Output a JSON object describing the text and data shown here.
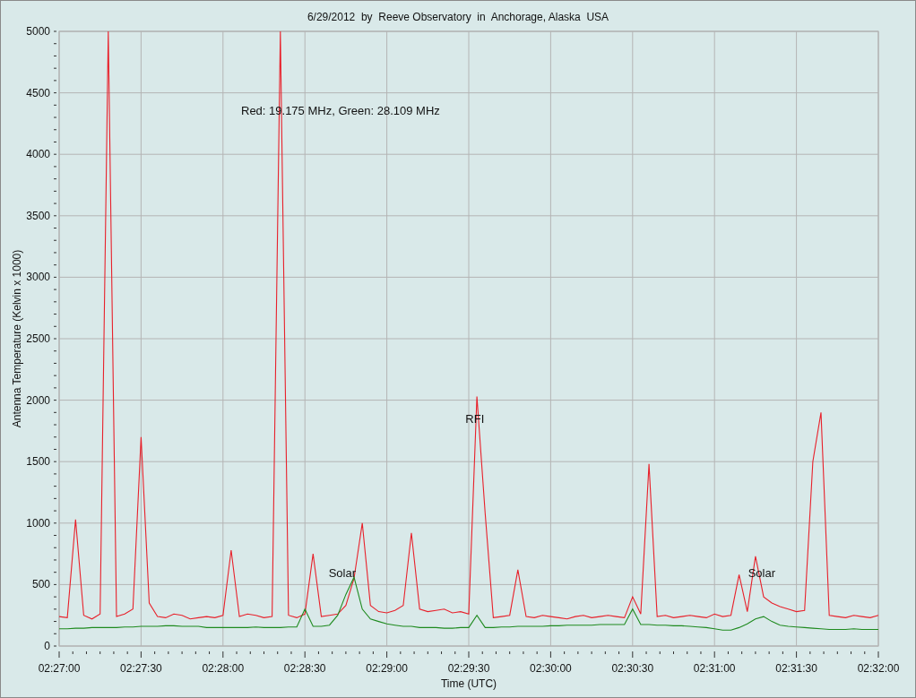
{
  "chart_data": {
    "type": "line",
    "title": "6/29/2012  by  Reeve Observatory  in  Anchorage, Alaska  USA",
    "xlabel": "Time (UTC)",
    "ylabel": "Antenna Temperature (Kelvin x 1000)",
    "categories": [
      "02:27:00",
      null,
      null,
      null,
      null,
      null,
      null,
      null,
      null,
      null,
      "02:27:30",
      null,
      null,
      null,
      null,
      null,
      null,
      null,
      null,
      null,
      "02:28:00",
      null,
      null,
      null,
      null,
      null,
      null,
      null,
      null,
      null,
      "02:28:30",
      null,
      null,
      null,
      null,
      null,
      null,
      null,
      null,
      null,
      "02:29:00",
      null,
      null,
      null,
      null,
      null,
      null,
      null,
      null,
      null,
      "02:29:30",
      null,
      null,
      null,
      null,
      null,
      null,
      null,
      null,
      null,
      "02:30:00",
      null,
      null,
      null,
      null,
      null,
      null,
      null,
      null,
      null,
      "02:30:30",
      null,
      null,
      null,
      null,
      null,
      null,
      null,
      null,
      null,
      "02:31:00",
      null,
      null,
      null,
      null,
      null,
      null,
      null,
      null,
      null,
      "02:31:30",
      null,
      null,
      null,
      null,
      null,
      null,
      null,
      null,
      null,
      "02:32:00"
    ],
    "series": [
      {
        "name": "Red: 19.175 MHz,",
        "color": "#e8202a",
        "values": [
          240,
          230,
          1030,
          250,
          220,
          260,
          5000,
          240,
          260,
          300,
          1700,
          350,
          240,
          230,
          260,
          250,
          220,
          230,
          240,
          230,
          250,
          780,
          240,
          260,
          250,
          230,
          240,
          5000,
          250,
          230,
          260,
          750,
          240,
          250,
          260,
          330,
          550,
          1000,
          330,
          280,
          270,
          290,
          330,
          920,
          300,
          280,
          290,
          300,
          270,
          280,
          260,
          2030,
          1080,
          230,
          240,
          250,
          620,
          240,
          230,
          250,
          240,
          230,
          220,
          240,
          250,
          230,
          240,
          250,
          240,
          230,
          400,
          260,
          1480,
          240,
          250,
          230,
          240,
          250,
          240,
          230,
          260,
          240,
          250,
          580,
          280,
          730,
          400,
          350,
          320,
          300,
          280,
          290,
          1500,
          1900,
          250,
          240,
          230,
          250,
          240,
          230,
          250
        ]
      },
      {
        "name": "Green: 28.109 MHz",
        "color": "#1e8a1e",
        "values": [
          140,
          140,
          145,
          145,
          150,
          150,
          150,
          150,
          155,
          155,
          160,
          160,
          160,
          165,
          165,
          160,
          160,
          160,
          150,
          150,
          150,
          150,
          150,
          150,
          155,
          150,
          150,
          150,
          155,
          155,
          300,
          160,
          160,
          170,
          250,
          420,
          560,
          300,
          220,
          200,
          180,
          170,
          160,
          160,
          150,
          150,
          150,
          145,
          145,
          150,
          150,
          250,
          150,
          150,
          155,
          155,
          160,
          160,
          160,
          160,
          165,
          165,
          170,
          170,
          170,
          170,
          175,
          175,
          175,
          175,
          300,
          175,
          175,
          170,
          170,
          165,
          165,
          160,
          155,
          150,
          140,
          130,
          130,
          150,
          180,
          220,
          240,
          200,
          170,
          160,
          155,
          150,
          145,
          140,
          135,
          135,
          135,
          140,
          135,
          135,
          135
        ]
      }
    ],
    "ylim": [
      0,
      5000
    ],
    "grid": true,
    "yticks": [
      0,
      500,
      1000,
      1500,
      2000,
      2500,
      3000,
      3500,
      4000,
      4500,
      5000
    ],
    "annotations": [
      "RFI",
      "Solar",
      "Solar"
    ]
  }
}
